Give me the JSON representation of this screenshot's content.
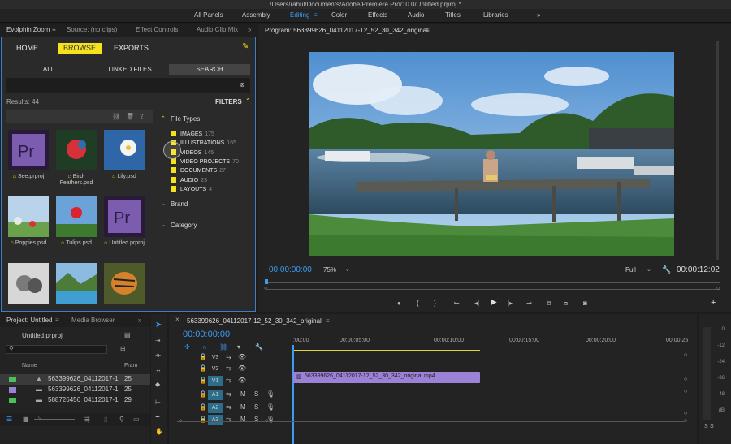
{
  "window": {
    "title": "/Users/rahul/Documents/Adobe/Premiere Pro/10.0/Untitled.prproj *"
  },
  "workspaces": [
    "All Panels",
    "Assembly",
    "Editing",
    "Color",
    "Effects",
    "Audio",
    "Titles",
    "Libraries"
  ],
  "workspace_active": "Editing",
  "top_left_tabs": [
    "Evolphin Zoom",
    "Source: (no clips)",
    "Effect Controls",
    "Audio Clip Mix"
  ],
  "evolphin": {
    "nav": [
      "HOME",
      "BROWSE",
      "EXPORTS"
    ],
    "segments": [
      "ALL",
      "LINKED FILES",
      "SEARCH"
    ],
    "results": "Results: 44",
    "filters_label": "FILTERS",
    "thumbnails": [
      {
        "name": "See.prproj",
        "kind": "pr"
      },
      {
        "name": "Bird-Feathers.psd",
        "kind": "bird"
      },
      {
        "name": "Lily.psd",
        "kind": "lily"
      },
      {
        "name": "Poppies.psd",
        "kind": "poppies"
      },
      {
        "name": "Tulips.psd",
        "kind": "tulips"
      },
      {
        "name": "Untitled.prproj",
        "kind": "pr"
      },
      {
        "name": "",
        "kind": "bw"
      },
      {
        "name": "",
        "kind": "valley"
      },
      {
        "name": "",
        "kind": "tiger"
      }
    ],
    "file_types_label": "File Types",
    "file_types": [
      {
        "label": "IMAGES",
        "count": "175"
      },
      {
        "label": "ILLUSTRATIONS",
        "count": "165"
      },
      {
        "label": "VIDEOS",
        "count": "145"
      },
      {
        "label": "VIDEO PROJECTS",
        "count": "70"
      },
      {
        "label": "DOCUMENTS",
        "count": "27"
      },
      {
        "label": "AUDIO",
        "count": "23"
      },
      {
        "label": "LAYOUTS",
        "count": "4"
      }
    ],
    "brand_label": "Brand",
    "category_label": "Category"
  },
  "program": {
    "title": "Program: 563399626_04112017-12_52_30_342_original",
    "timecode": "00:00:00:00",
    "zoom": "75%",
    "quality": "Full",
    "duration": "00:00:12:02"
  },
  "project": {
    "tabs": [
      "Project: Untitled",
      "Media Browser"
    ],
    "file": "Untitled.prproj",
    "col_name": "Name",
    "col_frame": "Fram",
    "rows": [
      {
        "name": "563399626_04112017-1",
        "fr": "25",
        "color": "#4dbf58"
      },
      {
        "name": "563399626_04112017-1",
        "fr": "25",
        "color": "#9c82d6"
      },
      {
        "name": "588726456_04112017-1",
        "fr": "29",
        "color": "#4dbf58"
      }
    ]
  },
  "timeline": {
    "tab": "563399626_04112017-12_52_30_342_original",
    "timecode": "00:00:00:00",
    "ruler": [
      ":00:00",
      "00:00:05:00",
      "00:00:10:00",
      "00:00:15:00",
      "00:00:20:00",
      "00:00:25"
    ],
    "tracks": [
      "V3",
      "V2",
      "V1",
      "A1",
      "A2",
      "A3"
    ],
    "track_m": "M",
    "track_s": "S",
    "clip": "563399626_04112017-12_52_30_342_original.mp4"
  },
  "meter_ticks": [
    "0",
    "-12",
    "-24",
    "-36",
    "-48",
    "dB"
  ],
  "colors": {
    "accent": "#3b9cf0",
    "yellow": "#f5e21d",
    "clip": "#9c82d6",
    "track_on": "#2b6d8a"
  }
}
